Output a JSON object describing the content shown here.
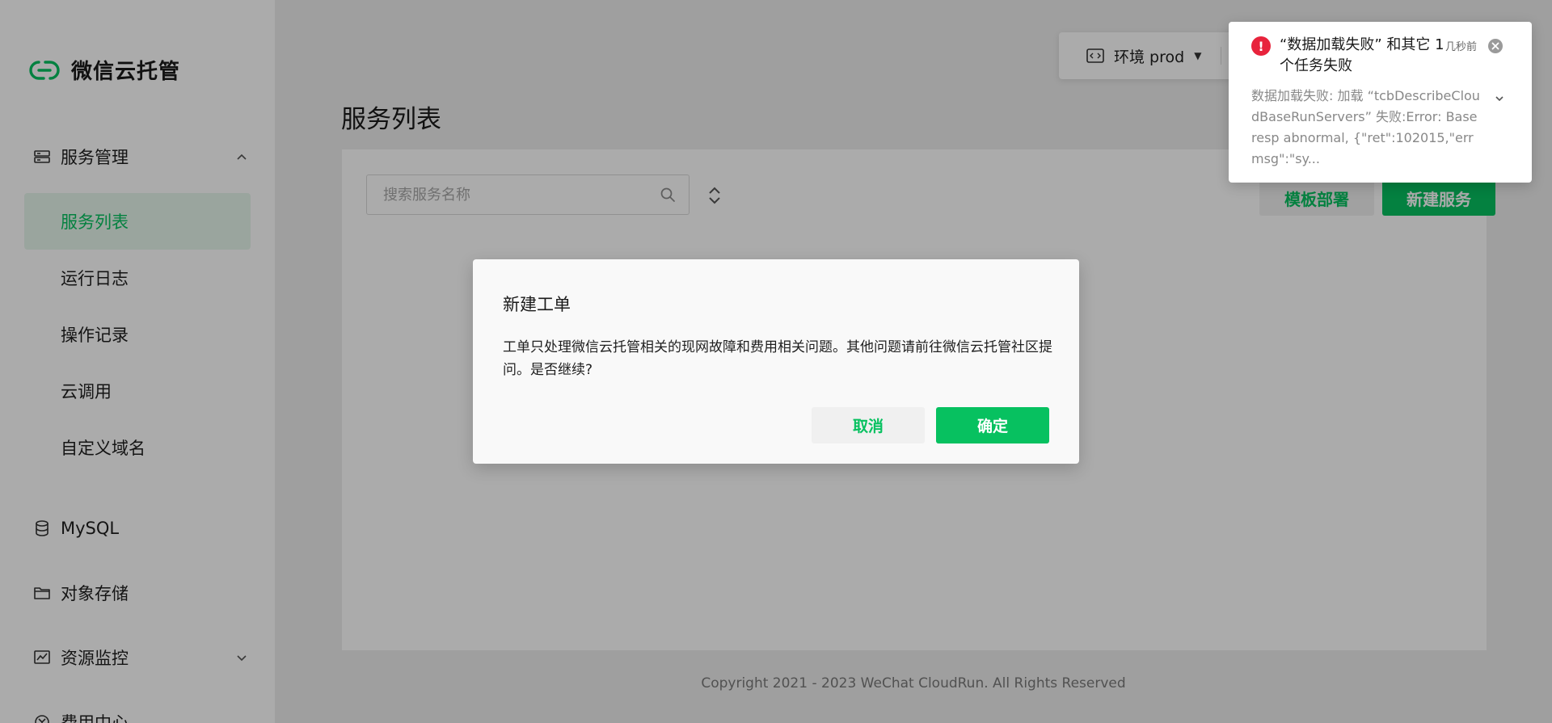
{
  "brand": {
    "name": "微信云托管",
    "accent": "#07c160"
  },
  "sidebar": {
    "groups": [
      {
        "label": "服务管理",
        "icon": "server-list-icon",
        "expanded": true
      },
      {
        "label": "MySQL",
        "icon": "database-icon"
      },
      {
        "label": "对象存储",
        "icon": "folder-icon"
      },
      {
        "label": "资源监控",
        "icon": "monitor-chart-icon",
        "expanded": false
      },
      {
        "label": "费用中心",
        "icon": "currency-circle-icon"
      }
    ],
    "service_items": [
      {
        "label": "服务列表",
        "active": true
      },
      {
        "label": "运行日志"
      },
      {
        "label": "操作记录"
      },
      {
        "label": "云调用"
      },
      {
        "label": "自定义域名"
      }
    ]
  },
  "header": {
    "env_label": "环境 prod"
  },
  "main": {
    "title": "服务列表",
    "search_placeholder": "搜索服务名称",
    "template_button": "模板部署",
    "new_service_button": "新建服务",
    "copyright": "Copyright 2021 - 2023 WeChat CloudRun. All Rights Reserved"
  },
  "modal": {
    "title": "新建工单",
    "body": "工单只处理微信云托管相关的现网故障和费用相关问题。其他问题请前往微信云托管社区提问。是否继续?",
    "cancel": "取消",
    "confirm": "确定"
  },
  "toast": {
    "title": "“数据加载失败” 和其它 1 个任务失败",
    "time": "几秒前",
    "message": "数据加载失败: 加载 “tcbDescribeCloudBaseRunServers” 失败:Error: Base resp abnormal, {\"ret\":102015,\"errmsg\":\"sy...",
    "error_color": "#e8233c"
  }
}
